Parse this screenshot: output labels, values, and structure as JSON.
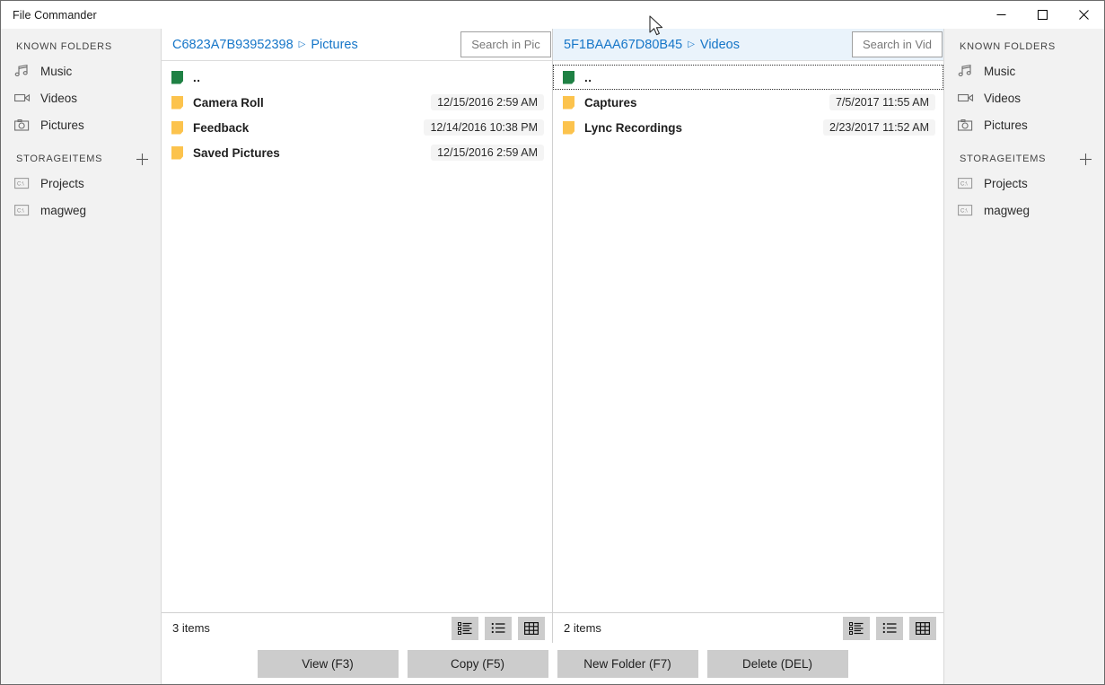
{
  "window": {
    "title": "File Commander",
    "controls": {
      "minimize": "minimize",
      "maximize": "maximize",
      "close": "close"
    }
  },
  "sidebar": {
    "known_folders_header": "KNOWN FOLDERS",
    "storage_items_header": "STORAGEITEMS",
    "add_label": "+",
    "known_folders": [
      {
        "label": "Music",
        "icon": "music-note-icon"
      },
      {
        "label": "Videos",
        "icon": "video-camera-icon"
      },
      {
        "label": "Pictures",
        "icon": "camera-icon"
      }
    ],
    "storage_items": [
      {
        "label": "Projects",
        "icon": "drive-icon"
      },
      {
        "label": "magweg",
        "icon": "drive-icon"
      }
    ]
  },
  "left_panel": {
    "active": false,
    "breadcrumb": {
      "root": "C6823A7B93952398",
      "separator": "▷",
      "current": "Pictures"
    },
    "search_label": "Search in Pic",
    "status": "3 items",
    "rows": [
      {
        "name": "..",
        "date": "",
        "icon": "up-folder-icon",
        "focused": false
      },
      {
        "name": "Camera Roll",
        "date": "12/15/2016 2:59 AM",
        "icon": "folder-icon",
        "focused": false
      },
      {
        "name": "Feedback",
        "date": "12/14/2016 10:38 PM",
        "icon": "folder-icon",
        "focused": false
      },
      {
        "name": "Saved Pictures",
        "date": "12/15/2016 2:59 AM",
        "icon": "folder-icon",
        "focused": false
      }
    ]
  },
  "right_panel": {
    "active": true,
    "breadcrumb": {
      "root": "5F1BAAA67D80B45",
      "separator": "▷",
      "current": "Videos"
    },
    "search_label": "Search in Vid",
    "status": "2 items",
    "rows": [
      {
        "name": "..",
        "date": "",
        "icon": "up-folder-icon",
        "focused": true
      },
      {
        "name": "Captures",
        "date": "7/5/2017 11:55 AM",
        "icon": "folder-icon",
        "focused": false
      },
      {
        "name": "Lync Recordings",
        "date": "2/23/2017 11:52 AM",
        "icon": "folder-icon",
        "focused": false
      }
    ]
  },
  "view_modes": [
    {
      "name": "detail-list-view",
      "icon": "detail-list-icon"
    },
    {
      "name": "list-view",
      "icon": "list-icon"
    },
    {
      "name": "grid-view",
      "icon": "grid-icon"
    }
  ],
  "commands": [
    {
      "label": "View (F3)",
      "name": "view-button"
    },
    {
      "label": "Copy (F5)",
      "name": "copy-button"
    },
    {
      "label": "New Folder (F7)",
      "name": "new-folder-button"
    },
    {
      "label": "Delete (DEL)",
      "name": "delete-button"
    }
  ],
  "colors": {
    "accent_link": "#1676c8",
    "folder": "#fcc34d",
    "up_folder": "#1f8144",
    "active_panel_bg": "#eaf3fb",
    "sidebar_bg": "#f2f2f2",
    "button_bg": "#cccccc"
  }
}
